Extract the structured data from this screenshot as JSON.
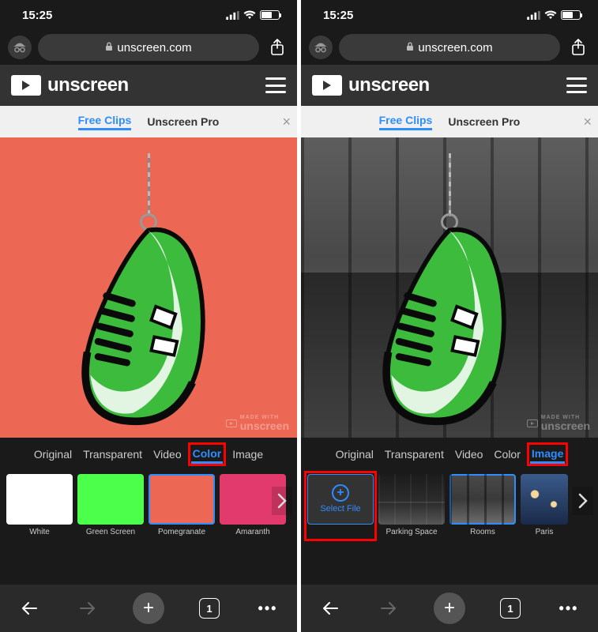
{
  "status": {
    "time": "15:25"
  },
  "address": {
    "domain": "unscreen.com"
  },
  "logo_text": "unscreen",
  "nav_tabs": {
    "free": "Free Clips",
    "pro": "Unscreen Pro"
  },
  "watermark": {
    "prefix": "MADE WITH",
    "brand": "unscreen"
  },
  "bg_tabs": [
    "Original",
    "Transparent",
    "Video",
    "Color",
    "Image"
  ],
  "left": {
    "active_bg_tab": "Color",
    "swatches": [
      {
        "name": "White",
        "color": "#ffffff"
      },
      {
        "name": "Green Screen",
        "color": "#4bff4b"
      },
      {
        "name": "Pomegranate",
        "color": "#ec6854"
      },
      {
        "name": "Amaranth",
        "color": "#e23a6d"
      }
    ],
    "selected_swatch": "Pomegranate"
  },
  "right": {
    "active_bg_tab": "Image",
    "select_file_label": "Select File",
    "thumbs": [
      {
        "name": "Parking Space"
      },
      {
        "name": "Rooms"
      },
      {
        "name": "Paris"
      }
    ],
    "selected_thumb": "Rooms"
  },
  "footer": {
    "tab_count": "1"
  }
}
